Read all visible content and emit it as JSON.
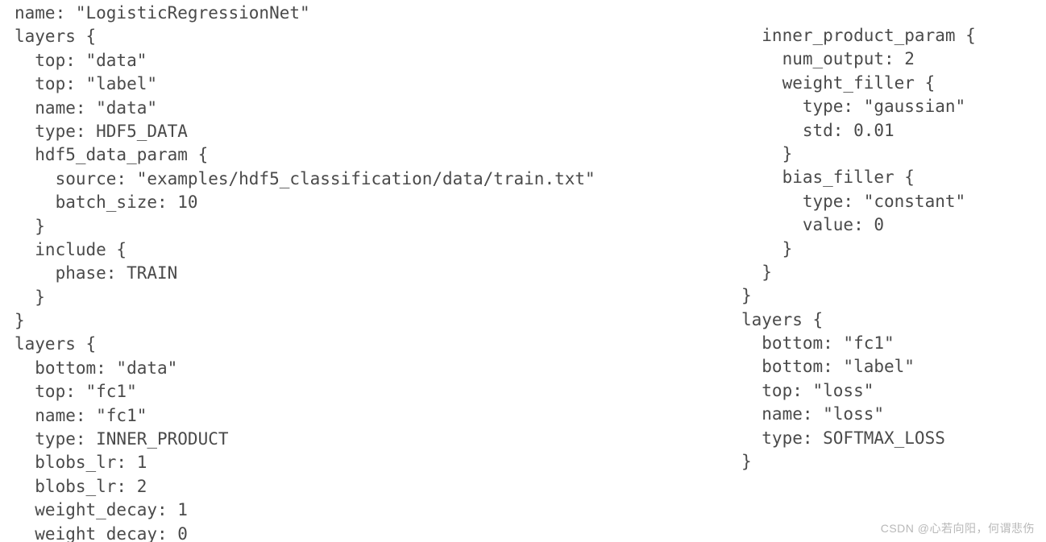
{
  "left_block": "name: \"LogisticRegressionNet\"\nlayers {\n  top: \"data\"\n  top: \"label\"\n  name: \"data\"\n  type: HDF5_DATA\n  hdf5_data_param {\n    source: \"examples/hdf5_classification/data/train.txt\"\n    batch_size: 10\n  }\n  include {\n    phase: TRAIN\n  }\n}\nlayers {\n  bottom: \"data\"\n  top: \"fc1\"\n  name: \"fc1\"\n  type: INNER_PRODUCT\n  blobs_lr: 1\n  blobs_lr: 2\n  weight_decay: 1\n  weight_decay: 0",
  "right_block": "  inner_product_param {\n    num_output: 2\n    weight_filler {\n      type: \"gaussian\"\n      std: 0.01\n    }\n    bias_filler {\n      type: \"constant\"\n      value: 0\n    }\n  }\n}\nlayers {\n  bottom: \"fc1\"\n  bottom: \"label\"\n  top: \"loss\"\n  name: \"loss\"\n  type: SOFTMAX_LOSS\n}",
  "watermark": "CSDN @心若向阳，何谓悲伤"
}
